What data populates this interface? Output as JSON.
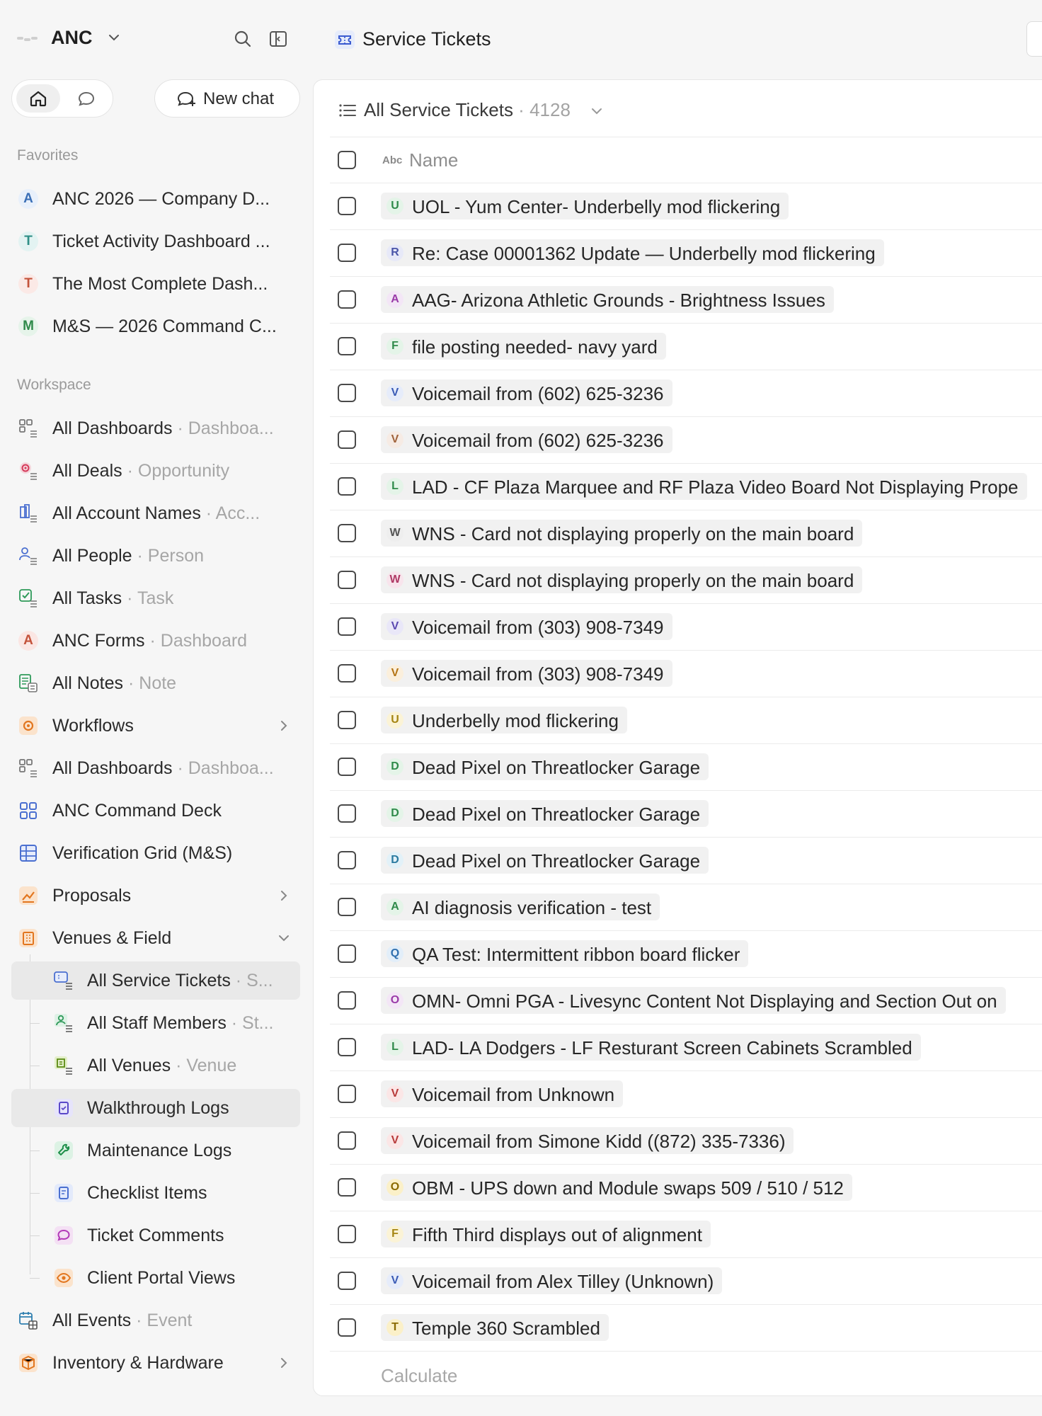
{
  "app": {
    "workspace": "ANC"
  },
  "new_chat_label": "New chat",
  "favorites_label": "Favorites",
  "favorites": [
    {
      "letter": "A",
      "label": "ANC 2026 — Company D...",
      "color": "#e8f0fb",
      "fg": "#3b6fb6"
    },
    {
      "letter": "T",
      "label": "Ticket Activity Dashboard ...",
      "color": "#e3f3f2",
      "fg": "#2f8f86"
    },
    {
      "letter": "T",
      "label": "The Most Complete Dash...",
      "color": "#fbe9e6",
      "fg": "#c4533b"
    },
    {
      "letter": "M",
      "label": "M&S — 2026 Command C...",
      "color": "#e6f4ea",
      "fg": "#2f8a4a"
    }
  ],
  "workspace_label": "Workspace",
  "workspace_items": [
    {
      "name": "dashboards",
      "icon": "dashboard-list-icon",
      "label": "All Dashboards",
      "sub": "Dashboa...",
      "chev": false
    },
    {
      "name": "deals",
      "icon": "deals-icon",
      "label": "All Deals",
      "sub": "Opportunity",
      "chev": false
    },
    {
      "name": "account-names",
      "icon": "building-icon",
      "label": "All Account Names",
      "sub": "Acc...",
      "chev": false
    },
    {
      "name": "people",
      "icon": "person-icon",
      "label": "All People",
      "sub": "Person",
      "chev": false
    },
    {
      "name": "tasks",
      "icon": "task-icon",
      "label": "All Tasks",
      "sub": "Task",
      "chev": false
    },
    {
      "name": "anc-forms",
      "icon": "letter-a-icon",
      "label": "ANC Forms",
      "sub": "Dashboard",
      "chev": false
    },
    {
      "name": "notes",
      "icon": "note-icon",
      "label": "All Notes",
      "sub": "Note",
      "chev": false
    },
    {
      "name": "workflows",
      "icon": "workflow-icon",
      "label": "Workflows",
      "sub": "",
      "chev": true
    },
    {
      "name": "dashboards-2",
      "icon": "dashboard-list-icon",
      "label": "All Dashboards",
      "sub": "Dashboa...",
      "chev": false
    },
    {
      "name": "command-deck",
      "icon": "grid-icon",
      "label": "ANC Command Deck",
      "sub": "",
      "chev": false
    },
    {
      "name": "verification-grid",
      "icon": "table-icon",
      "label": "Verification Grid (M&S)",
      "sub": "",
      "chev": false
    },
    {
      "name": "proposals",
      "icon": "chart-icon",
      "label": "Proposals",
      "sub": "",
      "chev": true
    },
    {
      "name": "venues-field",
      "icon": "venue-icon",
      "label": "Venues & Field",
      "sub": "",
      "chev": true
    }
  ],
  "venue_children": [
    {
      "name": "service-tickets",
      "icon": "ticket-list-icon",
      "label": "All Service Tickets",
      "sub": "S...",
      "active": true
    },
    {
      "name": "staff-members",
      "icon": "staff-icon",
      "label": "All Staff Members",
      "sub": "St...",
      "active": false
    },
    {
      "name": "venues",
      "icon": "venue-list-icon",
      "label": "All Venues",
      "sub": "Venue",
      "active": false
    },
    {
      "name": "walkthrough-logs",
      "icon": "clipboard-icon",
      "label": "Walkthrough Logs",
      "sub": "",
      "active": true
    },
    {
      "name": "maintenance-logs",
      "icon": "wrench-icon",
      "label": "Maintenance Logs",
      "sub": "",
      "active": false
    },
    {
      "name": "checklist-items",
      "icon": "checklist-icon",
      "label": "Checklist Items",
      "sub": "",
      "active": false
    },
    {
      "name": "ticket-comments",
      "icon": "comment-icon",
      "label": "Ticket Comments",
      "sub": "",
      "active": false
    },
    {
      "name": "client-portal-views",
      "icon": "eye-icon",
      "label": "Client Portal Views",
      "sub": "",
      "active": false
    }
  ],
  "bottom_items": [
    {
      "name": "events",
      "icon": "calendar-icon",
      "label": "All Events",
      "sub": "Event",
      "chev": false
    },
    {
      "name": "inventory",
      "icon": "box-icon",
      "label": "Inventory & Hardware",
      "sub": "",
      "chev": true
    }
  ],
  "main": {
    "title": "Service Tickets",
    "view_name": "All Service Tickets",
    "view_count": "4128",
    "column_type": "Abc",
    "column_name": "Name",
    "footer_label": "Calculate"
  },
  "tickets": [
    {
      "letter": "U",
      "text": "UOL - Yum Center- Underbelly mod flickering",
      "bg": "#e4f4e8",
      "fg": "#2f8a4a"
    },
    {
      "letter": "R",
      "text": "Re: Case 00001362 Update — Underbelly mod flickering",
      "bg": "#e7e9f8",
      "fg": "#4a55a8"
    },
    {
      "letter": "A",
      "text": "AAG- Arizona Athletic Grounds - Brightness Issues",
      "bg": "#f3e6f6",
      "fg": "#9a3aa8"
    },
    {
      "letter": "F",
      "text": "file posting needed- navy yard",
      "bg": "#e4f4e8",
      "fg": "#2f8a4a"
    },
    {
      "letter": "V",
      "text": "Voicemail from (602) 625-3236",
      "bg": "#e6ecfa",
      "fg": "#3a5bb6"
    },
    {
      "letter": "V",
      "text": "Voicemail from (602) 625-3236",
      "bg": "#f6ebe4",
      "fg": "#a0623a"
    },
    {
      "letter": "L",
      "text": "LAD - CF Plaza Marquee and RF Plaza Video Board Not Displaying Prope",
      "bg": "#e4f4e8",
      "fg": "#2f8a4a"
    },
    {
      "letter": "W",
      "text": "WNS - Card not displaying properly on the main board",
      "bg": "#eeeeee",
      "fg": "#555555"
    },
    {
      "letter": "W",
      "text": "WNS - Card not displaying properly on the main board",
      "bg": "#f8e4ec",
      "fg": "#b03a66"
    },
    {
      "letter": "V",
      "text": "Voicemail from (303) 908-7349",
      "bg": "#e9e7f8",
      "fg": "#5a48b0"
    },
    {
      "letter": "V",
      "text": "Voicemail from (303) 908-7349",
      "bg": "#fbefdc",
      "fg": "#b47414"
    },
    {
      "letter": "U",
      "text": "Underbelly mod flickering",
      "bg": "#fbf3d6",
      "fg": "#a58512"
    },
    {
      "letter": "D",
      "text": "Dead Pixel on Threatlocker Garage",
      "bg": "#e4f4e8",
      "fg": "#2f8a4a"
    },
    {
      "letter": "D",
      "text": "Dead Pixel on Threatlocker Garage",
      "bg": "#e4f4e8",
      "fg": "#2f8a4a"
    },
    {
      "letter": "D",
      "text": "Dead Pixel on Threatlocker Garage",
      "bg": "#e2f1f8",
      "fg": "#2a7aa0"
    },
    {
      "letter": "A",
      "text": "AI diagnosis verification - test",
      "bg": "#e4f4e8",
      "fg": "#2f8a4a"
    },
    {
      "letter": "Q",
      "text": "QA Test: Intermittent ribbon board flicker",
      "bg": "#e2eef9",
      "fg": "#2f6fae"
    },
    {
      "letter": "O",
      "text": "OMN- Omni PGA - Livesync Content Not Displaying and Section Out on",
      "bg": "#f3e6f6",
      "fg": "#9a3aa8"
    },
    {
      "letter": "L",
      "text": "LAD- LA Dodgers - LF Resturant Screen Cabinets Scrambled",
      "bg": "#e4f4e8",
      "fg": "#2f8a4a"
    },
    {
      "letter": "V",
      "text": "Voicemail from Unknown",
      "bg": "#fbe6e6",
      "fg": "#b83a3a"
    },
    {
      "letter": "V",
      "text": "Voicemail from Simone Kidd ((872) 335-7336)",
      "bg": "#fbe6e6",
      "fg": "#b83a3a"
    },
    {
      "letter": "O",
      "text": "OBM - UPS down and Module swaps 509 / 510 / 512",
      "bg": "#fbf0c8",
      "fg": "#8a6a00"
    },
    {
      "letter": "F",
      "text": "Fifth Third displays out of alignment",
      "bg": "#fbf3d6",
      "fg": "#a58512"
    },
    {
      "letter": "V",
      "text": "Voicemail from Alex Tilley (Unknown)",
      "bg": "#e6ecfa",
      "fg": "#3a5bb6"
    },
    {
      "letter": "T",
      "text": "Temple 360 Scrambled",
      "bg": "#fbf0c8",
      "fg": "#8a6a00"
    }
  ]
}
